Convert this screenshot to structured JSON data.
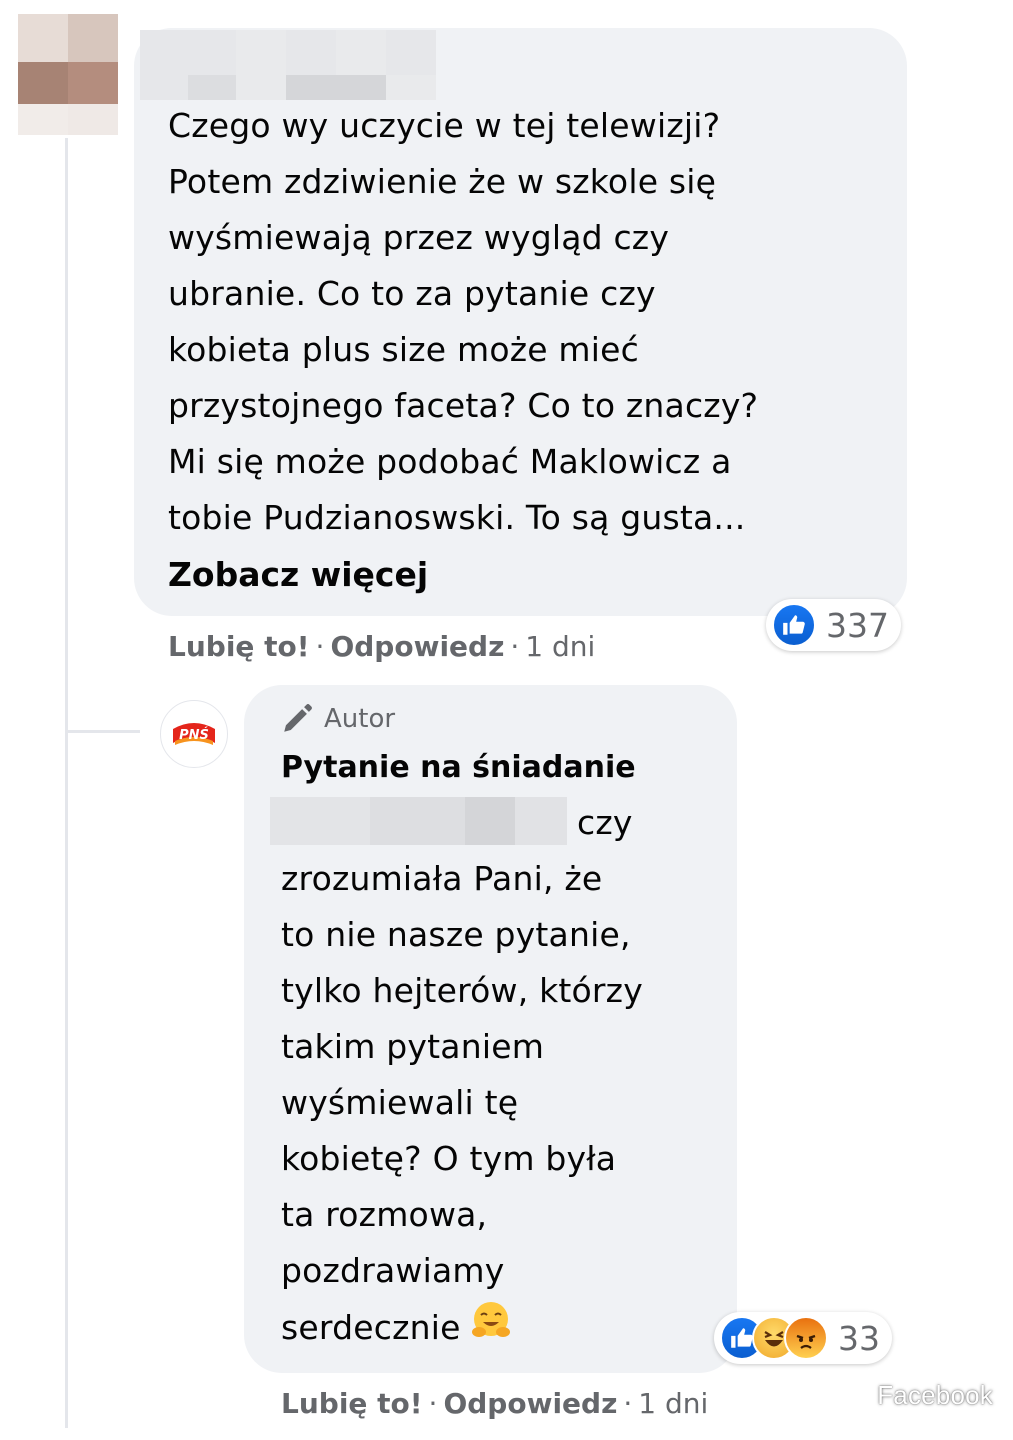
{
  "comment": {
    "author_name": "",
    "text_lines": [
      "Czego wy uczycie w tej telewizji?",
      "Potem zdziwienie że w szkole się",
      "wyśmiewają przez wygląd czy",
      "ubranie. Co to za pytanie czy",
      "kobieta plus size może mieć",
      "przystojnego faceta? Co to znaczy?",
      "Mi się może podobać Maklowicz a",
      "tobie Pudzianoswski. To są gusta..."
    ],
    "see_more": "Zobacz więcej",
    "reactions": {
      "icons": [
        "like-icon"
      ],
      "count": "337"
    },
    "actions": {
      "like": "Lubię to!",
      "reply": "Odpowiedz",
      "separator": "·",
      "time": "1 dni"
    }
  },
  "reply": {
    "author_badge": "Autor",
    "author_badge_icon": "pencil-icon",
    "page_name": "Pytanie na śniadanie",
    "page_avatar_text": "PNŚ",
    "text_lines": [
      "czy",
      "zrozumiała Pani, że",
      "to nie nasze pytanie,",
      "tylko hejterów, którzy",
      "takim pytaniem",
      "wyśmiewali tę",
      "kobietę? O tym była",
      "ta rozmowa,",
      "pozdrawiamy",
      "serdecznie"
    ],
    "emoji": "hugging-face-icon",
    "reactions": {
      "icons": [
        "like-icon",
        "haha-icon",
        "angry-icon"
      ],
      "count": "33"
    },
    "actions": {
      "like": "Lubię to!",
      "reply": "Odpowiedz",
      "separator": "·",
      "time": "1 dni"
    }
  },
  "watermark": "Facebook",
  "colors": {
    "bubble": "#f0f2f5",
    "meta_text": "#65676b",
    "like_blue": "#1877f2",
    "pns_red": "#e4251b",
    "pns_orange": "#f7931e"
  }
}
